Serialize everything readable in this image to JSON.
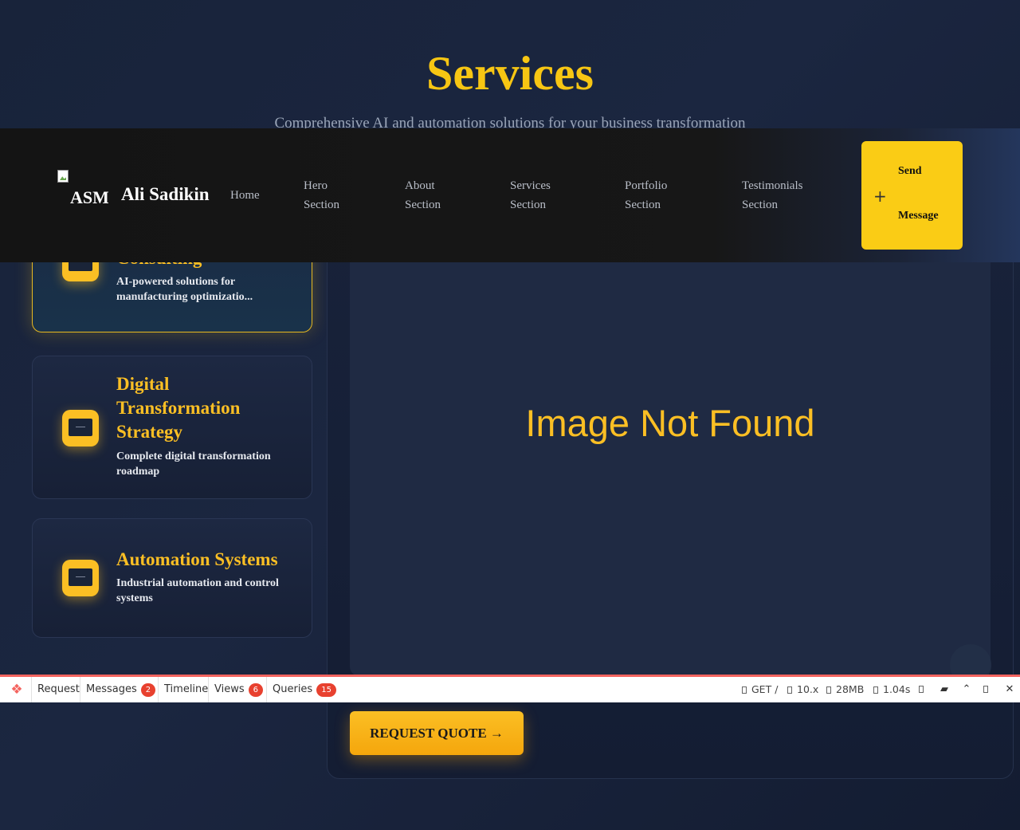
{
  "services": {
    "title": "Services",
    "subtitle": "Comprehensive AI and automation solutions for your business transformation"
  },
  "cards": [
    {
      "title": "Consulting",
      "description": "AI-powered solutions for manufacturing optimizatio...",
      "icon": "monitor-icon",
      "active": true
    },
    {
      "title": "Digital Transformation Strategy",
      "description": "Complete digital transformation roadmap",
      "icon": "monitor-icon",
      "active": false
    },
    {
      "title": "Automation Systems",
      "description": "Industrial automation and control systems",
      "icon": "monitor-icon",
      "active": false
    }
  ],
  "panel": {
    "image_text": "Image Not Found",
    "quote_button": "REQUEST QUOTE →"
  },
  "navbar": {
    "logo_alt": "ASM",
    "brand": "Ali Sadikin",
    "links": [
      {
        "line1": "Home",
        "line2": ""
      },
      {
        "line1": "Hero",
        "line2": "Section"
      },
      {
        "line1": "About",
        "line2": "Section"
      },
      {
        "line1": "Services",
        "line2": "Section"
      },
      {
        "line1": "Portfolio",
        "line2": "Section"
      },
      {
        "line1": "Testimonials",
        "line2": "Section"
      }
    ],
    "send_button": {
      "icon": "plus-icon",
      "line1": "Send",
      "line2": "Message"
    }
  },
  "debugbar": {
    "tabs": [
      {
        "label": "Request",
        "badge": ""
      },
      {
        "label": "Messages",
        "badge": "2"
      },
      {
        "label": "Timeline",
        "badge": ""
      },
      {
        "label": "Views",
        "badge": "6"
      },
      {
        "label": "Queries",
        "badge": "15"
      }
    ],
    "method": "GET /",
    "version": "10.x",
    "memory": "28MB",
    "time": "1.04s"
  },
  "colors": {
    "accent": "#fbbf24",
    "background": "#1b2640",
    "navbar": "#171717",
    "debug_accent": "#f4645f"
  }
}
